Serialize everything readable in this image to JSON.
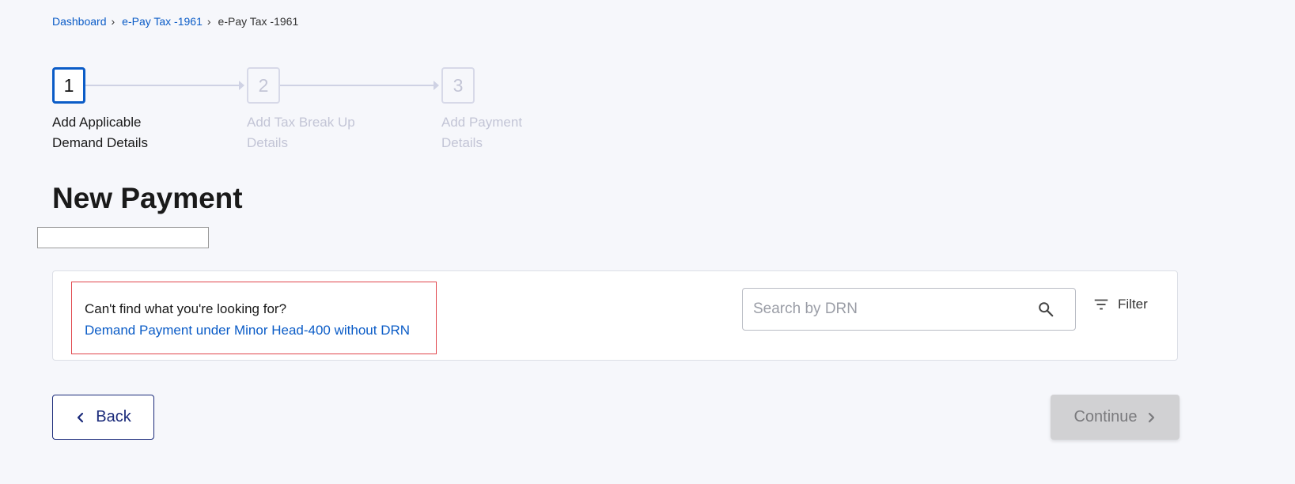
{
  "breadcrumb": {
    "items": [
      "Dashboard",
      "e-Pay Tax -1961",
      "e-Pay Tax -1961"
    ]
  },
  "stepper": {
    "steps": [
      {
        "number": "1",
        "line1": "Add Applicable",
        "line2": "Demand Details",
        "state": "active"
      },
      {
        "number": "2",
        "line1": "Add Tax Break Up",
        "line2": "Details",
        "state": "inactive"
      },
      {
        "number": "3",
        "line1": "Add Payment",
        "line2": "Details",
        "state": "inactive"
      }
    ]
  },
  "page": {
    "title": "New Payment"
  },
  "card": {
    "hint_text": "Can't find what you're looking for?",
    "hint_link": "Demand Payment under Minor Head-400 without DRN",
    "search": {
      "value": "",
      "placeholder": "Search by DRN",
      "icon": "search-icon"
    },
    "filter": {
      "label": "Filter",
      "icon": "filter-icon"
    }
  },
  "actions": {
    "back_label": "Back",
    "continue_label": "Continue"
  },
  "colors": {
    "accent": "#0b5cc7",
    "navy": "#1a2a7a",
    "error_border": "#e0454b",
    "disabled_bg": "#d1d1d3"
  }
}
